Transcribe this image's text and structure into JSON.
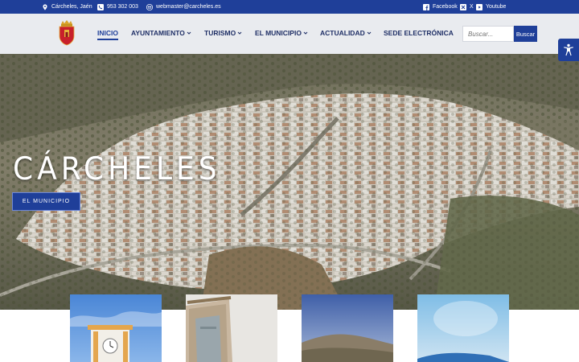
{
  "topbar": {
    "location": "Cárcheles, Jaén",
    "phone": "953 302 003",
    "email": "webmaster@carcheles.es",
    "social": [
      {
        "icon": "facebook-icon",
        "label": "Facebook"
      },
      {
        "icon": "x-icon",
        "label": "X"
      },
      {
        "icon": "youtube-icon",
        "label": "Youtube"
      }
    ]
  },
  "header": {
    "nav": [
      {
        "label": "INICIO",
        "active": true,
        "dropdown": false
      },
      {
        "label": "AYUNTAMIENTO",
        "active": false,
        "dropdown": true
      },
      {
        "label": "TURISMO",
        "active": false,
        "dropdown": true
      },
      {
        "label": "EL MUNICIPIO",
        "active": false,
        "dropdown": true
      },
      {
        "label": "ACTUALIDAD",
        "active": false,
        "dropdown": true
      },
      {
        "label": "SEDE ELECTRÓNICA",
        "active": false,
        "dropdown": false
      }
    ],
    "search": {
      "placeholder": "Buscar...",
      "button": "Buscar"
    }
  },
  "hero": {
    "title": "CÁRCHELES",
    "button": "EL MUNICIPIO"
  },
  "colors": {
    "brand": "#1f3f99",
    "header_bg": "#e8eaee"
  },
  "cards": [
    "clock-tower-image",
    "stone-door-image",
    "mountain-image",
    "water-image"
  ]
}
